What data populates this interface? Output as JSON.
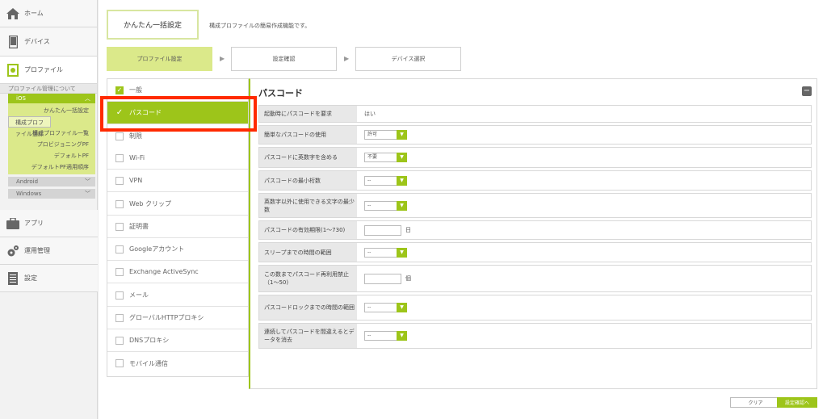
{
  "nav": {
    "home": "ホーム",
    "device": "デバイス",
    "profile": "プロファイル",
    "profile_manage": "プロファイル管理について",
    "ios": "iOS",
    "ios_items": [
      "かんたん一括設定",
      "構成プロファイル登録",
      "構成プロファイル一覧",
      "プロビジョニングPF",
      "デフォルトPF",
      "デフォルトPF適用順序"
    ],
    "android": "Android",
    "windows": "Windows",
    "app": "アプリ",
    "ops": "運用管理",
    "settings": "設定"
  },
  "header": {
    "title": "かんたん一括設定",
    "description": "構成プロファイルの簡易作成機能です。"
  },
  "steps": [
    "プロファイル設定",
    "設定確認",
    "デバイス選択"
  ],
  "categories": [
    "一般",
    "パスコード",
    "制限",
    "Wi-Fi",
    "VPN",
    "Web クリップ",
    "証明書",
    "Googleアカウント",
    "Exchange ActiveSync",
    "メール",
    "グローバルHTTPプロキシ",
    "DNSプロキシ",
    "モバイル通信"
  ],
  "panel": {
    "title": "パスコード",
    "rows": [
      {
        "label": "起動時にパスコードを要求",
        "value": "はい"
      },
      {
        "label": "簡単なパスコードの使用",
        "value": "許可"
      },
      {
        "label": "パスコードに英数字を含める",
        "value": "不要"
      },
      {
        "label": "パスコードの最小桁数",
        "value": "--"
      },
      {
        "label": "英数字以外に使用できる文字の最少数",
        "value": "--"
      },
      {
        "label": "パスコードの有効期限(1〜730)",
        "value": "",
        "unit": "日"
      },
      {
        "label": "スリープまでの時間の範囲",
        "value": "--"
      },
      {
        "label": "この数までパスコード再利用禁止（1〜50)",
        "value": "",
        "unit": "個"
      },
      {
        "label": "パスコードロックまでの時間の範囲",
        "value": "--"
      },
      {
        "label": "連続してパスコードを間違えるとデータを消去",
        "value": "--"
      }
    ]
  },
  "buttons": {
    "clear": "クリア",
    "next": "設定確認へ"
  }
}
